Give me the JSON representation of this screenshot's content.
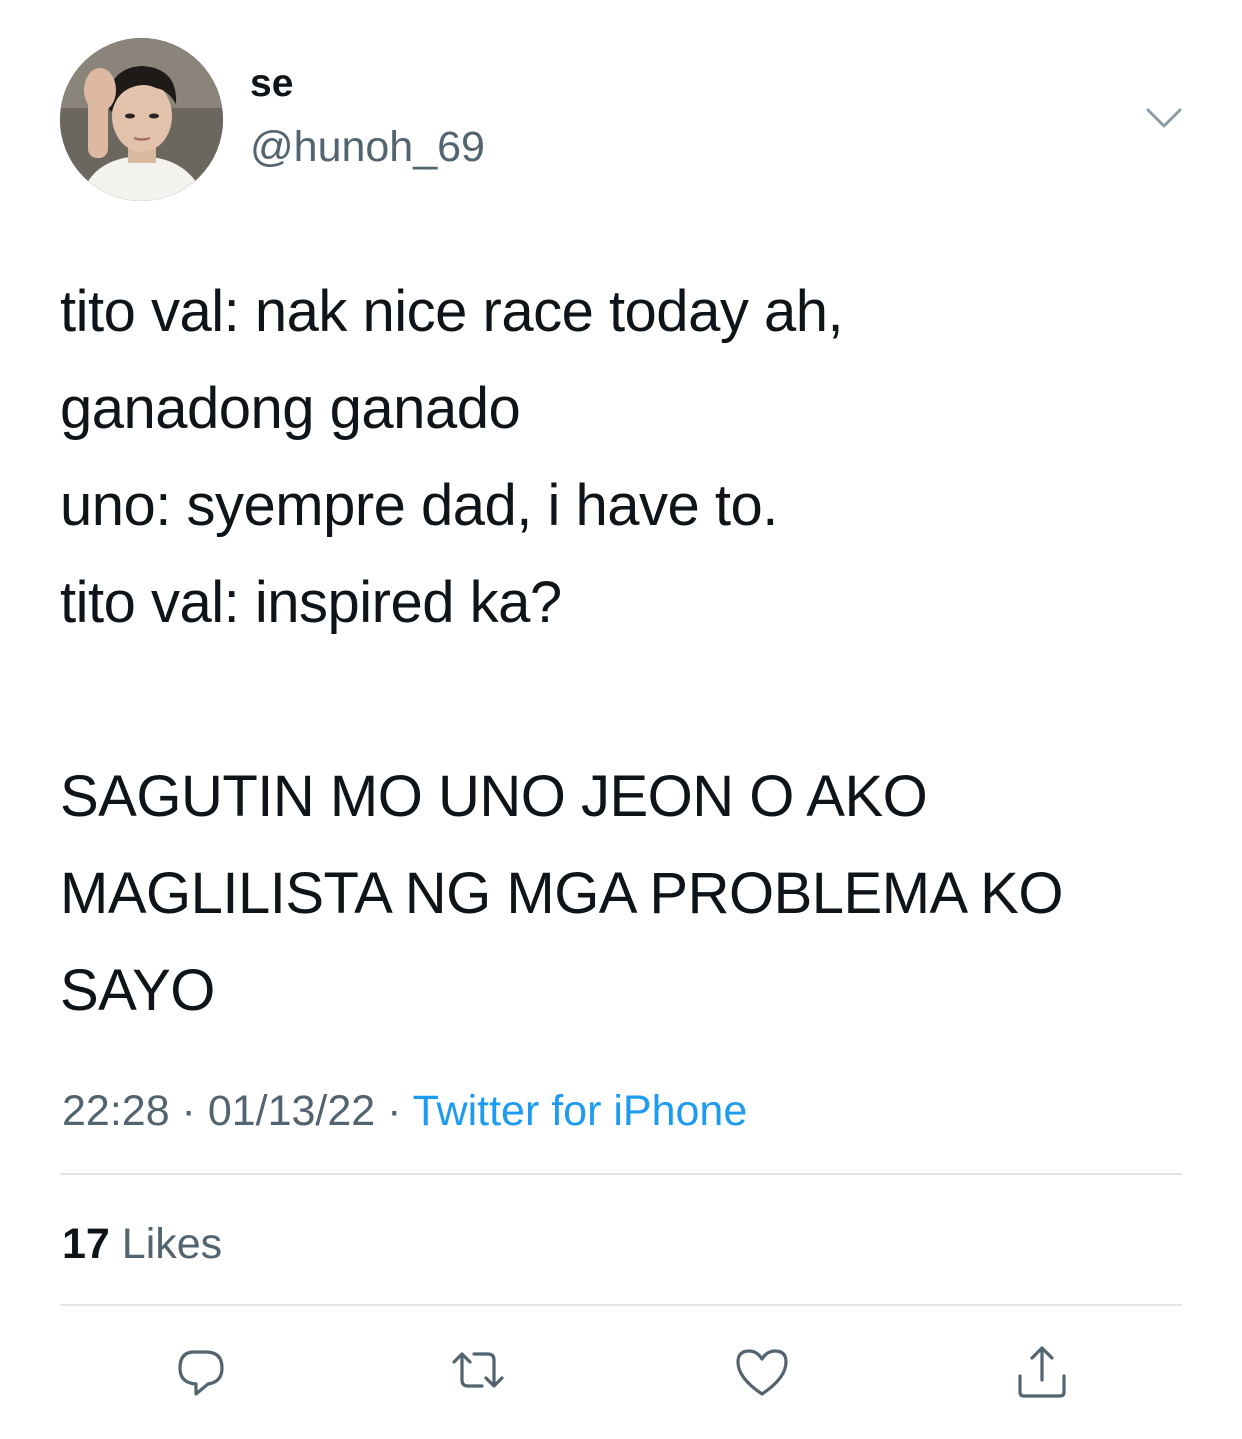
{
  "tweet": {
    "author": {
      "display_name": "se",
      "handle": "@hunoh_69",
      "avatar_icon": "profile-photo"
    },
    "more_icon": "chevron-down-icon",
    "lines": [
      "tito val: nak nice race today ah,",
      "ganadong ganado",
      "uno: syempre dad, i have to.",
      "tito val: inspired ka?",
      "",
      "SAGUTIN MO UNO JEON O AKO",
      "MAGLILISTA NG MGA PROBLEMA KO",
      "SAYO"
    ],
    "time": "22:28",
    "separator": " · ",
    "date": "01/13/22",
    "source": "Twitter for iPhone",
    "likes_count": "17",
    "likes_label": "Likes",
    "actions": [
      "reply-icon",
      "retweet-icon",
      "like-icon",
      "share-icon"
    ]
  },
  "colors": {
    "text": "#0f1419",
    "muted": "#536471",
    "link": "#1d9bf0",
    "divider": "#e1e5e8"
  }
}
